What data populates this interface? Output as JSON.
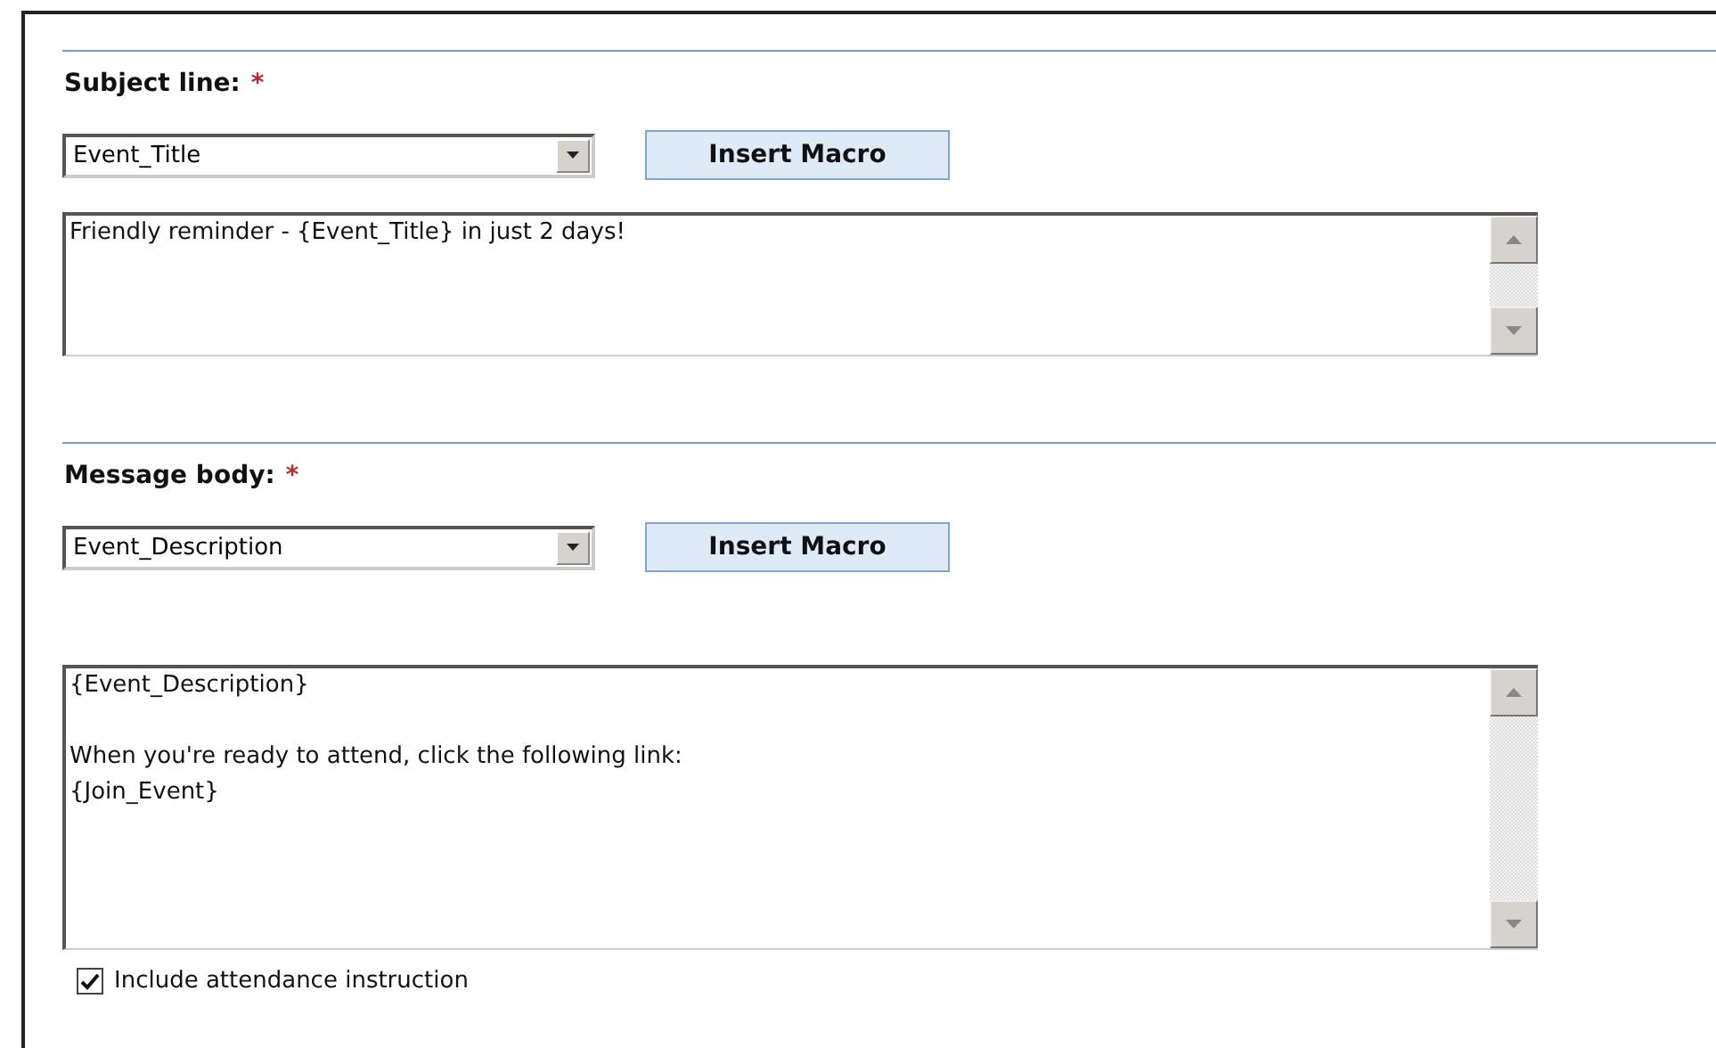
{
  "sections": [
    {
      "label": "Subject line:",
      "required": "*",
      "macro_select": {
        "value": "Event_Title"
      },
      "insert_button": "Insert Macro",
      "text": "Friendly reminder - {Event_Title} in just 2 days!"
    },
    {
      "label": "Message body:",
      "required": "*",
      "macro_select": {
        "value": "Event_Description"
      },
      "insert_button": "Insert Macro",
      "text": "{Event_Description}\n\nWhen you're ready to attend, click the following link:\n{Join_Event}"
    }
  ],
  "checkbox": {
    "label": "Include attendance instruction",
    "checked": true
  }
}
